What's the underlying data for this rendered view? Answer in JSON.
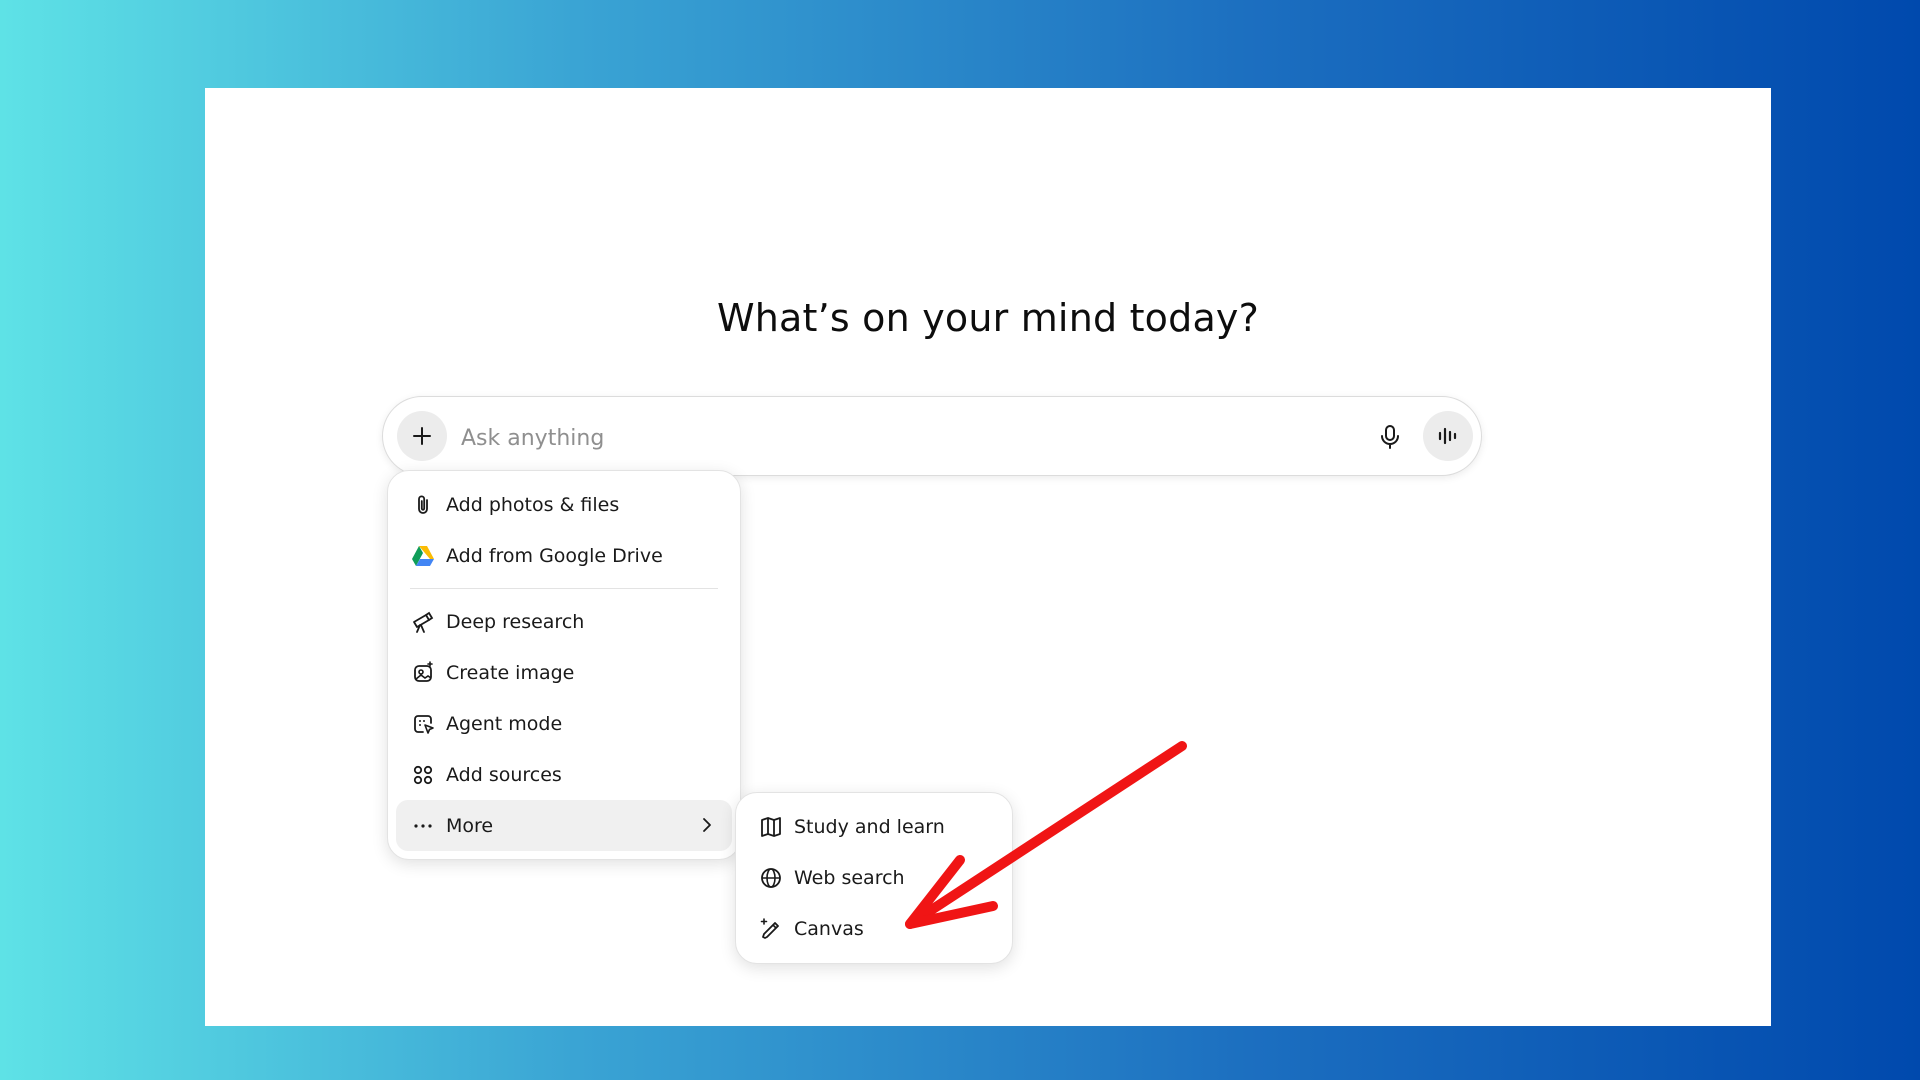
{
  "headline": "What’s on your mind today?",
  "composer": {
    "placeholder": "Ask anything",
    "value": ""
  },
  "menu": {
    "items": [
      {
        "label": "Add photos & files",
        "icon": "paperclip-icon"
      },
      {
        "label": "Add from Google Drive",
        "icon": "google-drive-icon"
      },
      {
        "label": "Deep research",
        "icon": "telescope-icon"
      },
      {
        "label": "Create image",
        "icon": "image-sparkle-icon"
      },
      {
        "label": "Agent mode",
        "icon": "agent-cursor-icon"
      },
      {
        "label": "Add sources",
        "icon": "sources-grid-icon"
      },
      {
        "label": "More",
        "icon": "more-dots-icon"
      }
    ]
  },
  "submenu": {
    "items": [
      {
        "label": "Study and learn",
        "icon": "book-icon"
      },
      {
        "label": "Web search",
        "icon": "globe-icon"
      },
      {
        "label": "Canvas",
        "icon": "pencil-sparkle-icon"
      }
    ]
  },
  "colors": {
    "annotation_arrow": "#f01515",
    "active_item_bg": "#f0f0f0",
    "button_bg": "#ececec"
  }
}
